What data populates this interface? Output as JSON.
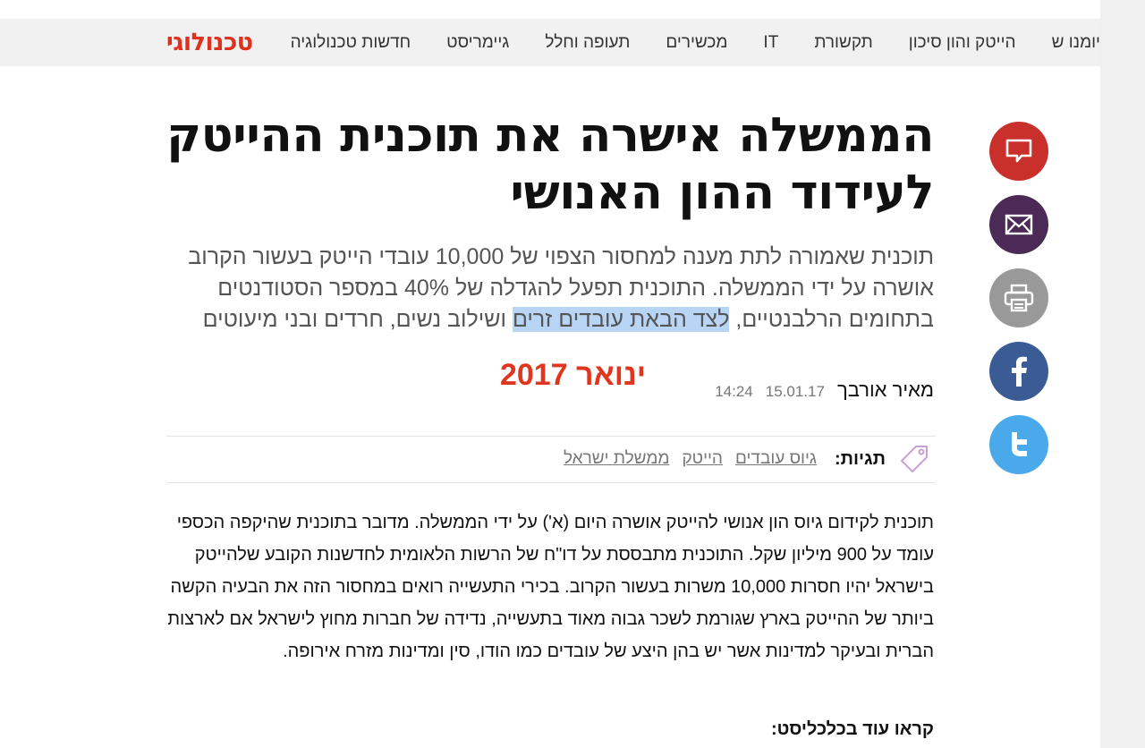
{
  "nav": {
    "brand": "טכנולוגי",
    "items": [
      "חדשות טכנולוגיה",
      "גיימריסט",
      "תעופה וחלל",
      "מכשירים",
      "IT",
      "תקשורת",
      "הייטק והון סיכון",
      "יומנו ש"
    ]
  },
  "share": {
    "buttons": [
      "comment-icon",
      "mail-icon",
      "print-icon",
      "facebook-icon",
      "twitter-icon"
    ],
    "colors": {
      "comment": "#c9302c",
      "mail": "#4b2a55",
      "print": "#999999",
      "facebook": "#3b5b95",
      "twitter": "#4aa9ea"
    }
  },
  "article": {
    "headline": "הממשלה אישרה את תוכנית ההייטק לעידוד ההון האנושי",
    "subtitle_before": "תוכנית שאמורה לתת מענה למחסור הצפוי של 10,000 עובדי הייטק בעשור הקרוב אושרה על ידי הממשלה. התוכנית תפעל להגדלה של 40% במספר הסטודנטים בתחומים הרלבנטיים, ",
    "subtitle_highlight": "לצד הבאת עובדים זרים",
    "subtitle_after": " ושילוב נשים, חרדים ובני מיעוטים",
    "author": "מאיר אורבך",
    "date": "15.01.17",
    "time": "14:24",
    "annotation": "ינואר 2017",
    "tags_label": "תגיות:",
    "tags": [
      "גיוס עובדים",
      "הייטק",
      "ממשלת ישראל"
    ],
    "body": "תוכנית לקידום גיוס הון אנושי להייטק אושרה היום (א') על ידי הממשלה. מדובר בתוכנית שהיקפה הכספי עומד על 900 מיליון שקל. התוכנית מתבססת על דו\"ח של הרשות הלאומית לחדשנות הקובע שלהייטק בישראל יהיו חסרות 10,000 משרות בעשור הקרוב. בכירי התעשייה רואים במחסור הזה את הבעיה הקשה ביותר של ההייטק בארץ שגורמת לשכר גבוה מאוד בתעשייה, נדידה של חברות מחוץ לישראל אם לארצות הברית ובעיקר למדינות אשר יש בהן היצע של עובדים כמו הודו, סין ומדינות מזרח אירופה.",
    "read_more": "קראו עוד בכלכליסט:"
  },
  "colors": {
    "brand": "#e0301e",
    "annotation": "#e0361f",
    "highlight": "#b9d5f5"
  }
}
